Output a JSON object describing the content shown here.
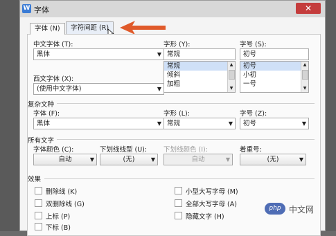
{
  "window": {
    "title": "字体",
    "app_icon": "W",
    "close_glyph": "✕"
  },
  "tabs": [
    {
      "label": "字体 (N)"
    },
    {
      "label": "字符间距 (R)"
    }
  ],
  "chinese_font": {
    "label": "中文字体 (T):",
    "value": "黑体"
  },
  "western_font": {
    "label": "西文字体 (X):",
    "value": "(使用中文字体)"
  },
  "style": {
    "label": "字形 (Y):",
    "value": "常规",
    "options": [
      "常规",
      "倾斜",
      "加粗"
    ]
  },
  "size": {
    "label": "字号 (S):",
    "value": "初号",
    "options": [
      "初号",
      "小初",
      "一号"
    ]
  },
  "complex": {
    "section": "复杂文种",
    "font_label": "字体 (F):",
    "font_value": "黑体",
    "style_label": "字形 (L):",
    "style_value": "常规",
    "size_label": "字号 (Z):",
    "size_value": "初号"
  },
  "all_text": {
    "section": "所有文字",
    "color_label": "字体颜色 (C):",
    "color_value": "自动",
    "underline_label": "下划线线型 (U):",
    "underline_value": "(无)",
    "underline_color_label": "下划线颜色 (I):",
    "underline_color_value": "自动",
    "emphasis_label": "着重号:",
    "emphasis_value": "(无)"
  },
  "effects": {
    "section": "效果",
    "left": [
      "删除线 (K)",
      "双删除线 (G)",
      "上标 (P)",
      "下标 (B)"
    ],
    "right": [
      "小型大写字母 (M)",
      "全部大写字母 (A)",
      "隐藏文字 (H)"
    ]
  },
  "watermark": {
    "logo": "php",
    "text": "中文网"
  },
  "icons": {
    "arrow": "red-arrow-icon",
    "cursor": "mouse-cursor-icon"
  }
}
